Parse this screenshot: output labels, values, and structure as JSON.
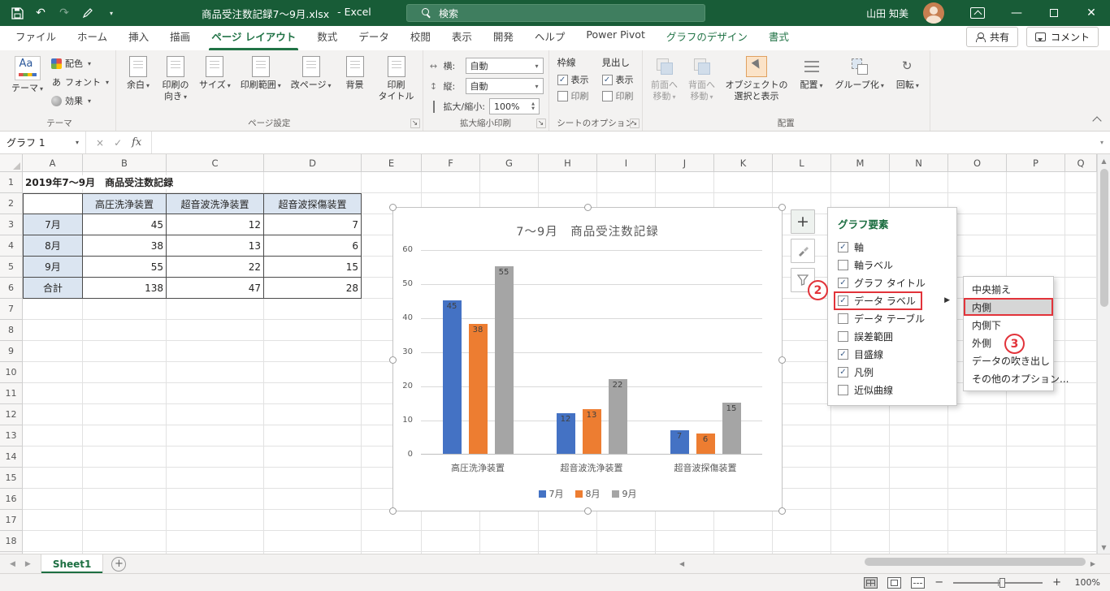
{
  "colors": {
    "title_bar": "#185c37",
    "accent": "#217346",
    "annotation_red": "#e2333a",
    "series_blue": "#4472c4",
    "series_orange": "#ed7d31",
    "series_gray": "#a5a5a5",
    "table_fill": "#dbe5f1"
  },
  "icons": {
    "caret": "▾",
    "check": "✓",
    "submenu_arrow": "▶",
    "undo": "↶",
    "redo": "↷",
    "up_arrow": "▲",
    "down_arrow": "▼",
    "left_arrow": "◀",
    "right_arrow": "▶"
  },
  "title_bar": {
    "document_title": "商品受注数記録7〜9月.xlsx",
    "app_suffix": "-  Excel",
    "search_label": "検索",
    "user_name": "山田 知美"
  },
  "ribbon": {
    "tabs": [
      {
        "label": "ファイル"
      },
      {
        "label": "ホーム"
      },
      {
        "label": "挿入"
      },
      {
        "label": "描画"
      },
      {
        "label": "ページ レイアウト",
        "active": true
      },
      {
        "label": "数式"
      },
      {
        "label": "データ"
      },
      {
        "label": "校閲"
      },
      {
        "label": "表示"
      },
      {
        "label": "開発"
      },
      {
        "label": "ヘルプ"
      },
      {
        "label": "Power Pivot"
      },
      {
        "label": "グラフのデザイン",
        "contextual": true
      },
      {
        "label": "書式",
        "contextual": true
      }
    ],
    "share_label": "共有",
    "comments_label": "コメント",
    "theme_group": {
      "label": "テーマ",
      "main_button": "テーマ",
      "items": [
        "配色",
        "フォント",
        "効果"
      ]
    },
    "page_setup_group": {
      "label": "ページ設定",
      "buttons": [
        {
          "lines": [
            "余白"
          ],
          "caret": true
        },
        {
          "lines": [
            "印刷の",
            "向き"
          ],
          "caret": true
        },
        {
          "lines": [
            "サイズ"
          ],
          "caret": true
        },
        {
          "lines": [
            "印刷範囲"
          ],
          "caret": true
        },
        {
          "lines": [
            "改ページ"
          ],
          "caret": true
        },
        {
          "lines": [
            "背景"
          ],
          "caret": false
        },
        {
          "lines": [
            "印刷",
            "タイトル"
          ],
          "caret": false
        }
      ]
    },
    "scale_group": {
      "label": "拡大縮小印刷",
      "width_label": "横:",
      "width_value": "自動",
      "height_label": "縦:",
      "height_value": "自動",
      "scale_label": "拡大/縮小:",
      "scale_value": "100%"
    },
    "sheet_options_group": {
      "label": "シートのオプション",
      "columns": [
        {
          "title": "枠線",
          "checks": [
            {
              "label": "表示",
              "checked": true
            },
            {
              "label": "印刷",
              "checked": false
            }
          ]
        },
        {
          "title": "見出し",
          "checks": [
            {
              "label": "表示",
              "checked": true
            },
            {
              "label": "印刷",
              "checked": false
            }
          ]
        }
      ]
    },
    "arrange_group": {
      "label": "配置",
      "buttons": [
        {
          "lines": [
            "前面へ",
            "移動"
          ],
          "caret": true,
          "disabled": true
        },
        {
          "lines": [
            "背面へ",
            "移動"
          ],
          "caret": true,
          "disabled": true
        },
        {
          "lines": [
            "オブジェクトの",
            "選択と表示"
          ],
          "caret": false
        },
        {
          "lines": [
            "配置"
          ],
          "caret": true
        },
        {
          "lines": [
            "グループ化"
          ],
          "caret": true
        },
        {
          "lines": [
            "回転"
          ],
          "caret": true
        }
      ]
    }
  },
  "formula_bar": {
    "name_box": "グラフ 1",
    "fx": "fx",
    "formula": ""
  },
  "sheet": {
    "columns": [
      "A",
      "B",
      "C",
      "D",
      "E",
      "F",
      "G",
      "H",
      "I",
      "J",
      "K",
      "L",
      "M",
      "N",
      "O",
      "P",
      "Q"
    ],
    "row_count": 19,
    "cells": [
      {
        "ref": "A1",
        "text": "2019年7〜9月　商品受注数記録",
        "style": "title"
      },
      {
        "ref": "A2",
        "text": "",
        "style": "box"
      },
      {
        "ref": "B2",
        "text": "高圧洗浄装置",
        "style": "header"
      },
      {
        "ref": "C2",
        "text": "超音波洗浄装置",
        "style": "header"
      },
      {
        "ref": "D2",
        "text": "超音波探傷装置",
        "style": "header"
      },
      {
        "ref": "A3",
        "text": "7月",
        "style": "rowlabel"
      },
      {
        "ref": "B3",
        "text": "45",
        "style": "num"
      },
      {
        "ref": "C3",
        "text": "12",
        "style": "num"
      },
      {
        "ref": "D3",
        "text": "7",
        "style": "num"
      },
      {
        "ref": "A4",
        "text": "8月",
        "style": "rowlabel"
      },
      {
        "ref": "B4",
        "text": "38",
        "style": "num"
      },
      {
        "ref": "C4",
        "text": "13",
        "style": "num"
      },
      {
        "ref": "D4",
        "text": "6",
        "style": "num"
      },
      {
        "ref": "A5",
        "text": "9月",
        "style": "rowlabel"
      },
      {
        "ref": "B5",
        "text": "55",
        "style": "num"
      },
      {
        "ref": "C5",
        "text": "22",
        "style": "num"
      },
      {
        "ref": "D5",
        "text": "15",
        "style": "num"
      },
      {
        "ref": "A6",
        "text": "合計",
        "style": "rowlabel"
      },
      {
        "ref": "B6",
        "text": "138",
        "style": "num"
      },
      {
        "ref": "C6",
        "text": "47",
        "style": "num"
      },
      {
        "ref": "D6",
        "text": "28",
        "style": "num"
      }
    ]
  },
  "chart_data": {
    "type": "bar",
    "title": "7〜9月　商品受注数記録",
    "categories": [
      "高圧洗浄装置",
      "超音波洗浄装置",
      "超音波探傷装置"
    ],
    "series": [
      {
        "name": "7月",
        "color": "#4472c4",
        "values": [
          45,
          12,
          7
        ]
      },
      {
        "name": "8月",
        "color": "#ed7d31",
        "values": [
          38,
          13,
          6
        ]
      },
      {
        "name": "9月",
        "color": "#a5a5a5",
        "values": [
          55,
          22,
          15
        ]
      }
    ],
    "ylim": [
      0,
      60
    ],
    "ytick_step": 10,
    "grid": true,
    "legend_position": "bottom",
    "data_labels": "inside_end"
  },
  "chart_elements_menu": {
    "title": "グラフ要素",
    "items": [
      {
        "label": "軸",
        "checked": true
      },
      {
        "label": "軸ラベル",
        "checked": false
      },
      {
        "label": "グラフ タイトル",
        "checked": true
      },
      {
        "label": "データ ラベル",
        "checked": true,
        "highlighted": true,
        "has_submenu": true
      },
      {
        "label": "データ テーブル",
        "checked": false
      },
      {
        "label": "誤差範囲",
        "checked": false
      },
      {
        "label": "目盛線",
        "checked": true
      },
      {
        "label": "凡例",
        "checked": true
      },
      {
        "label": "近似曲線",
        "checked": false
      }
    ]
  },
  "data_label_submenu": {
    "items": [
      {
        "label": "中央揃え"
      },
      {
        "label": "内側",
        "selected": true,
        "highlighted": true
      },
      {
        "label": "内側下"
      },
      {
        "label": "外側"
      },
      {
        "label": "データの吹き出し"
      },
      {
        "label": "その他のオプション..."
      }
    ]
  },
  "annotations": {
    "step2": "2",
    "step3": "3"
  },
  "sheet_tabs": {
    "active": "Sheet1"
  },
  "status_bar": {
    "zoom": "100%"
  }
}
